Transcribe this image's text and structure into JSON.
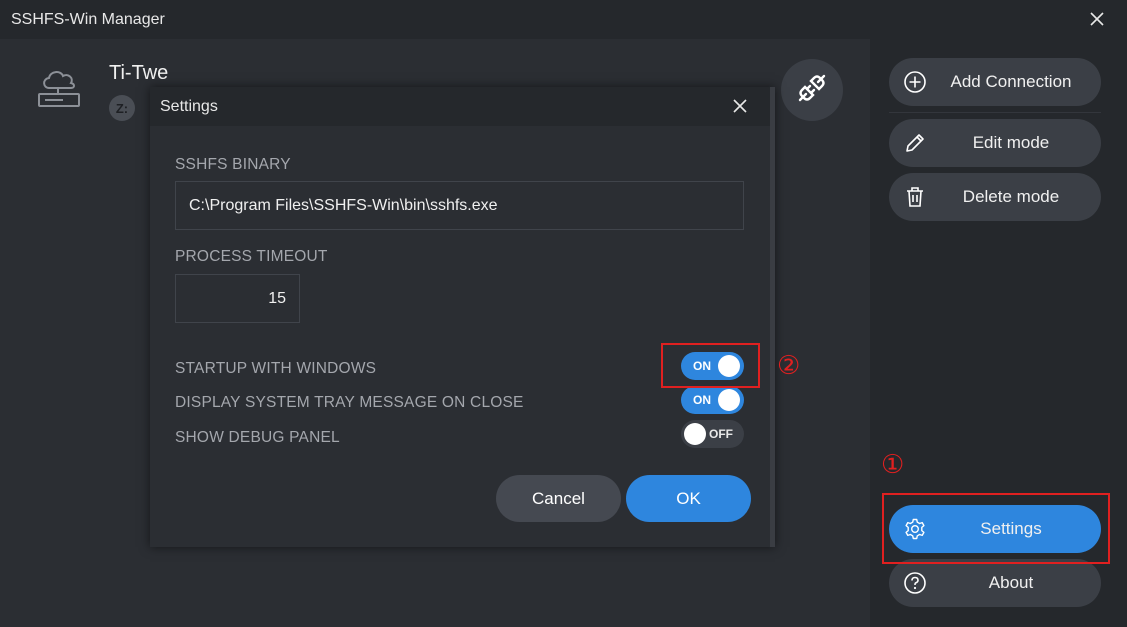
{
  "window": {
    "title": "SSHFS-Win Manager"
  },
  "connection": {
    "name": "Ti-Twe",
    "drive_letter": "Z:"
  },
  "sidebar": {
    "add_connection": "Add Connection",
    "edit_mode": "Edit mode",
    "delete_mode": "Delete mode",
    "settings": "Settings",
    "about": "About"
  },
  "settings_dialog": {
    "title": "Settings",
    "sshfs_binary_label": "SSHFS BINARY",
    "sshfs_binary_value": "C:\\Program Files\\SSHFS-Win\\bin\\sshfs.exe",
    "process_timeout_label": "PROCESS TIMEOUT",
    "process_timeout_value": "15",
    "startup_label": "STARTUP WITH WINDOWS",
    "startup_toggle": "ON",
    "tray_label": "DISPLAY SYSTEM TRAY MESSAGE ON CLOSE",
    "tray_toggle": "ON",
    "debug_label": "SHOW DEBUG PANEL",
    "debug_toggle": "OFF",
    "cancel": "Cancel",
    "ok": "OK"
  },
  "annotations": {
    "step1": "①",
    "step2": "②"
  },
  "colors": {
    "accent": "#2e86de",
    "annotation": "#e02020",
    "background": "#2b2e33",
    "titlebar": "#25282c"
  },
  "icons": [
    "close-icon",
    "cloud-server-icon",
    "plug-icon",
    "plus-circle-icon",
    "pencil-icon",
    "trash-icon",
    "gear-icon",
    "help-circle-icon"
  ]
}
